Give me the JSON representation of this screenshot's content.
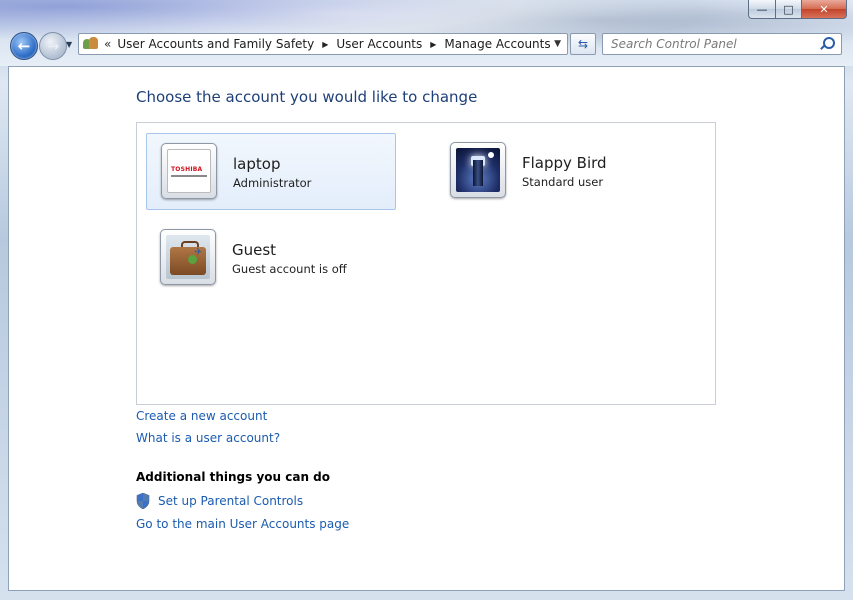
{
  "window": {
    "caption_buttons": {
      "minimize": "—",
      "maximize": "□",
      "close": "✕"
    }
  },
  "nav": {
    "back_glyph": "←",
    "forward_glyph": "→",
    "recent_glyph": "▼"
  },
  "address_bar": {
    "overflow_glyph": "«",
    "segments": [
      "User Accounts and Family Safety",
      "User Accounts",
      "Manage Accounts"
    ],
    "separator_glyph": "▶",
    "dropdown_glyph": "▼",
    "refresh_glyph": "⇆"
  },
  "search": {
    "placeholder": "Search Control Panel"
  },
  "main": {
    "title": "Choose the account you would like to change",
    "accounts": [
      {
        "name": "laptop",
        "role": "Administrator",
        "picture_icon": "toshiba-logo-icon",
        "picture_text": "TOSHIBA"
      },
      {
        "name": "Flappy Bird",
        "role": "Standard user",
        "picture_icon": "lighthouse-icon"
      },
      {
        "name": "Guest",
        "role": "Guest account is off",
        "picture_icon": "suitcase-icon"
      }
    ],
    "links": {
      "create_account": "Create a new account",
      "what_is_account": "What is a user account?"
    },
    "additional": {
      "heading": "Additional things you can do",
      "parental_controls": "Set up Parental Controls",
      "main_user_accounts": "Go to the main User Accounts page"
    }
  },
  "colors": {
    "link": "#1b5bb0",
    "title": "#1e3f78",
    "selected_tile_border": "#a9c6ea"
  }
}
